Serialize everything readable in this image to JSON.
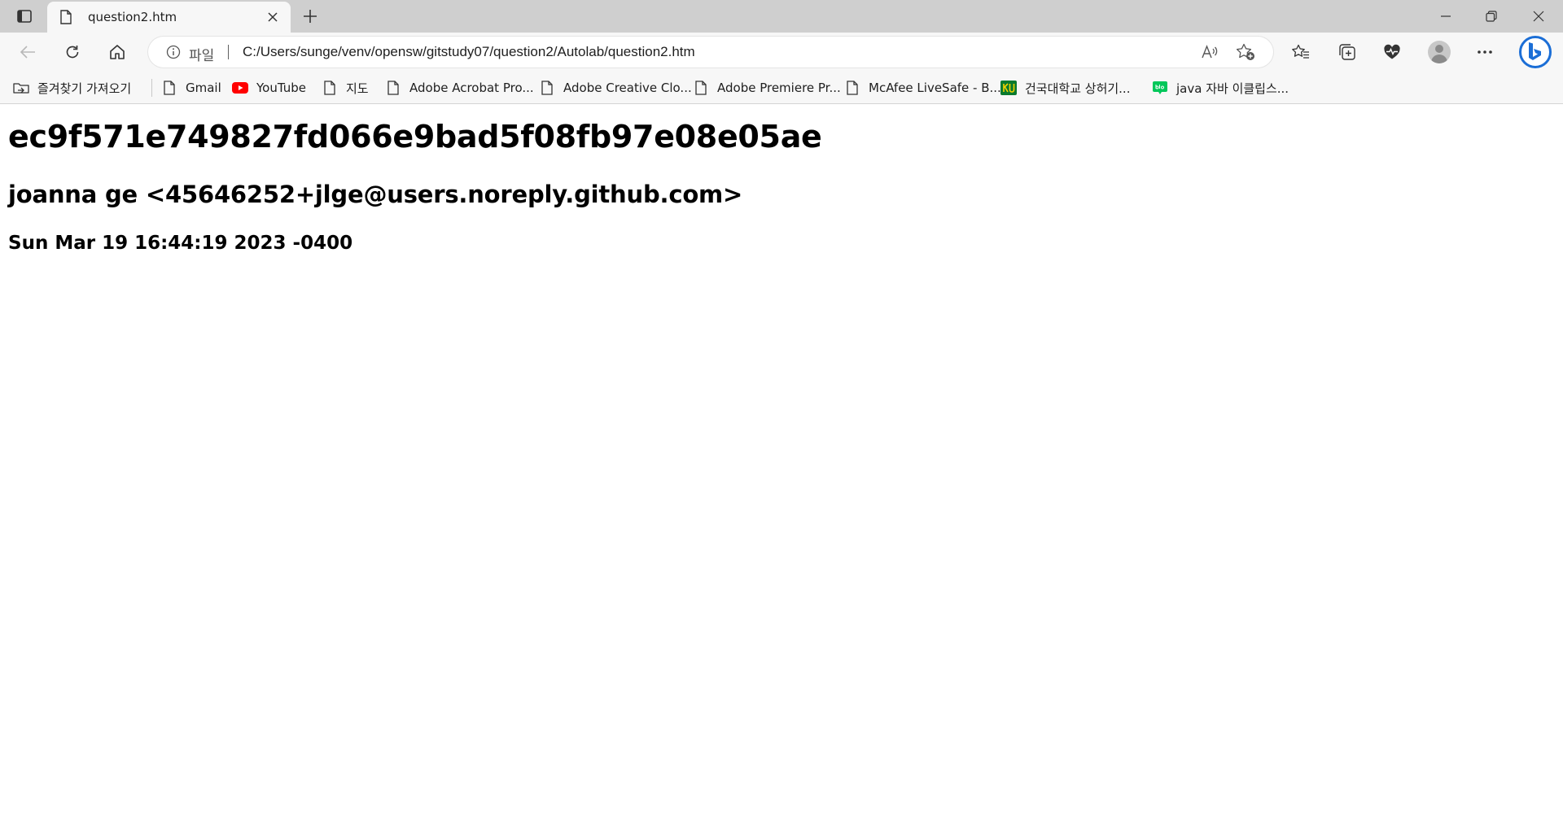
{
  "window": {
    "tab_title": "question2.htm",
    "icons": {
      "tab_actions": "tab-actions-icon",
      "page": "page-icon",
      "close_tab": "close-icon",
      "new_tab": "plus-icon",
      "minimize": "minimize-icon",
      "restore": "restore-icon",
      "close_window": "close-icon"
    }
  },
  "toolbar": {
    "address": {
      "scheme_label": "파일",
      "url": "C:/Users/sunge/venv/opensw/gitstudy07/question2/Autolab/question2.htm"
    },
    "icons": [
      "back-icon",
      "refresh-icon",
      "home-icon",
      "info-icon",
      "read-aloud-icon",
      "add-favorite-icon",
      "favorites-icon",
      "collections-icon",
      "browser-essentials-icon",
      "profile-avatar",
      "more-icon",
      "bing-icon"
    ]
  },
  "bookmarks": [
    {
      "label": "즐겨찾기 가져오기",
      "icon": "import-icon"
    },
    {
      "label": "Gmail",
      "icon": "page-icon"
    },
    {
      "label": "YouTube",
      "icon": "youtube-icon"
    },
    {
      "label": "지도",
      "icon": "page-icon"
    },
    {
      "label": "Adobe Acrobat Pro...",
      "icon": "page-icon"
    },
    {
      "label": "Adobe Creative Clo...",
      "icon": "page-icon"
    },
    {
      "label": "Adobe Premiere Pr...",
      "icon": "page-icon"
    },
    {
      "label": "McAfee LiveSafe - B...",
      "icon": "page-icon"
    },
    {
      "label": "건국대학교 상허기...",
      "icon": "ku-logo-icon"
    },
    {
      "label": "java 자바 이클립스...",
      "icon": "blog-icon"
    }
  ],
  "page": {
    "commit_hash": "ec9f571e749827fd066e9bad5f08fb97e08e05ae",
    "author": "joanna ge <45646252+jlge@users.noreply.github.com>",
    "date": "Sun Mar 19 16:44:19 2023 -0400"
  },
  "colors": {
    "title_bar": "#cfcfcf",
    "toolbar": "#f7f7f7",
    "youtube_red": "#ff0000",
    "ku_green": "#0a7a2e",
    "blog_green": "#03c75a",
    "bing_blue": "#1b6ed6"
  }
}
